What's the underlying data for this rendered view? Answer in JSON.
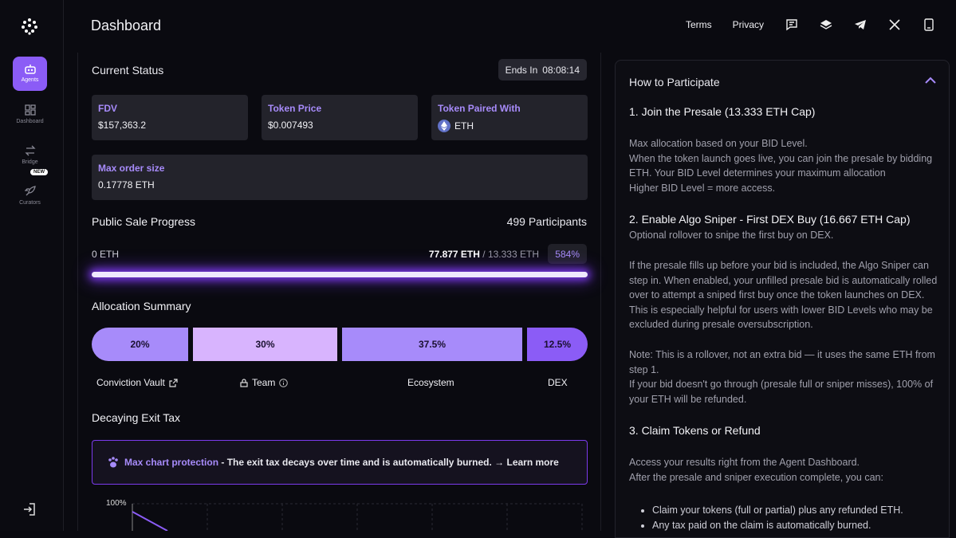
{
  "sidebar": {
    "items": [
      {
        "label": "Agents",
        "icon": "bot-icon",
        "active": true
      },
      {
        "label": "Dashboard",
        "icon": "grid-icon"
      },
      {
        "label": "Bridge",
        "icon": "swap-icon"
      },
      {
        "label": "Curators",
        "icon": "rocket-icon",
        "badge": "NEW"
      }
    ]
  },
  "header": {
    "title": "Dashboard",
    "links": [
      "Terms",
      "Privacy"
    ]
  },
  "status": {
    "title": "Current Status",
    "ends_label": "Ends In",
    "ends_value": "08:08:14",
    "fdv_label": "FDV",
    "fdv_value": "$157,363.2",
    "price_label": "Token Price",
    "price_value": "$0.007493",
    "paired_label": "Token Paired With",
    "paired_value": "ETH",
    "max_label": "Max order size",
    "max_value": "0.17778 ETH"
  },
  "progress": {
    "title": "Public Sale Progress",
    "participants": "499 Participants",
    "start": "0 ETH",
    "raised": "77.877 ETH",
    "cap": "/ 13.333 ETH",
    "percent": "584%",
    "fill_fraction": 1.0
  },
  "allocation": {
    "title": "Allocation Summary",
    "segments": [
      {
        "pct": "20%",
        "label": "Conviction Vault",
        "color": "#a78bfa"
      },
      {
        "pct": "30%",
        "label": "Team",
        "color": "#d8b4fe"
      },
      {
        "pct": "37.5%",
        "label": "Ecosystem",
        "color": "#a78bfa"
      },
      {
        "pct": "12.5%",
        "label": "DEX",
        "color": "#8b5cf6"
      }
    ]
  },
  "exit_tax": {
    "title": "Decaying Exit Tax",
    "highlight": "Max chart protection",
    "text": " - The exit tax decays over time and is automatically burned. → ",
    "link": "Learn more",
    "axis_label": "100%"
  },
  "participate": {
    "title": "How to Participate",
    "step1_title": "1. Join the Presale (13.333 ETH Cap)",
    "step1_lines": [
      "Max allocation based on your BID Level.",
      "When the token launch goes live, you can join the presale by bidding ETH. Your BID Level determines your maximum allocation",
      "Higher BID Level = more access."
    ],
    "step2_title": "2. Enable Algo Sniper - First DEX Buy (16.667 ETH Cap)",
    "step2_sub": "Optional rollover to snipe the first buy on DEX.",
    "step2_p1": "If the presale fills up before your bid is included, the Algo Sniper can step in. When enabled, your unfilled presale bid is automatically rolled over to attempt a sniped first buy once the token launches on DEX. This is especially helpful for users with lower BID Levels who may be excluded during presale oversubscription.",
    "step2_p2a": "Note: This is a rollover, not an extra bid — it uses the same ETH from step 1.",
    "step2_p2b": "If your bid doesn't go through (presale full or sniper misses), 100% of your ETH will be refunded.",
    "step3_title": "3. Claim Tokens or Refund",
    "step3_p1": "Access your results right from the Agent Dashboard.",
    "step3_p2": "After the presale and sniper execution complete, you can:",
    "step3_items": [
      "Claim your tokens (full or partial) plus any refunded ETH.",
      "Any tax paid on the claim is automatically burned."
    ]
  }
}
